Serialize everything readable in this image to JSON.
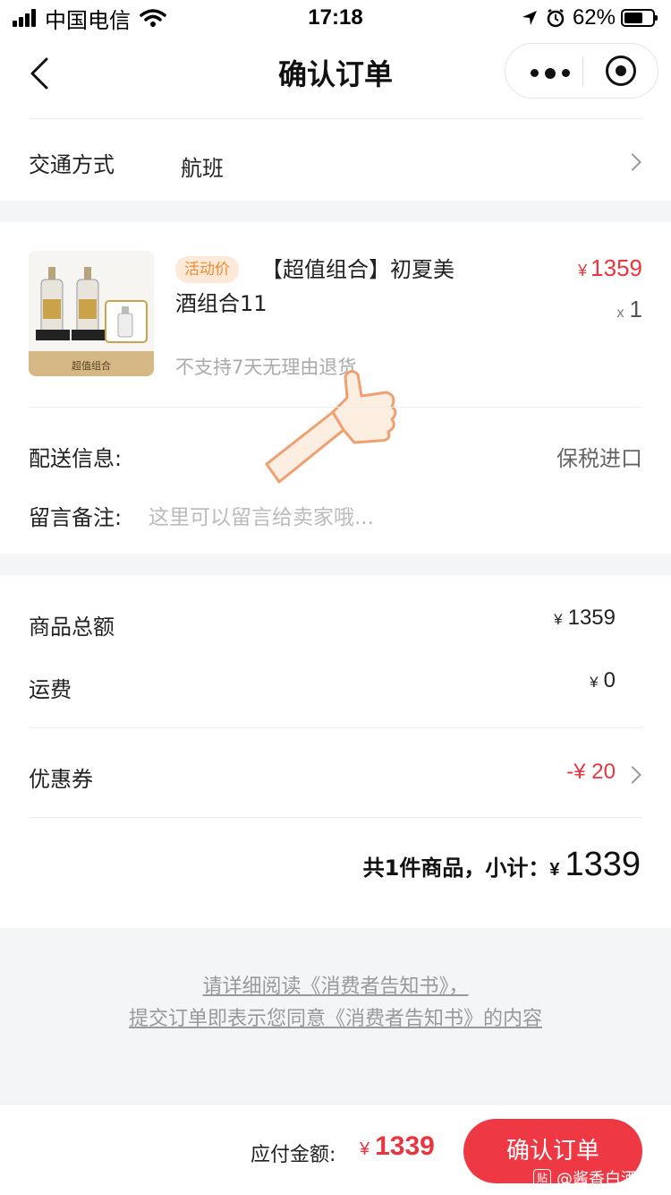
{
  "status_bar": {
    "carrier": "中国电信",
    "time": "17:18",
    "battery_percent": "62%"
  },
  "nav": {
    "title": "确认订单"
  },
  "transport": {
    "label": "交通方式",
    "value": "航班"
  },
  "product": {
    "image_caption": "超值组合",
    "badge": "活动价",
    "title": "【超值组合】初夏美酒组合11",
    "price_currency": "¥",
    "price": "1359",
    "qty_prefix": "x",
    "qty": "1",
    "return_policy": "不支持7天无理由退货"
  },
  "delivery": {
    "label": "配送信息:",
    "value": "保税进口"
  },
  "remark": {
    "label": "留言备注:",
    "placeholder": "这里可以留言给卖家哦..."
  },
  "summary": {
    "goods_total_label": "商品总额",
    "goods_total_currency": "¥",
    "goods_total": "1359",
    "shipping_label": "运费",
    "shipping_currency": "¥",
    "shipping": "0",
    "coupon_label": "优惠券",
    "coupon_value": "-¥ 20",
    "subtotal_label": "共1件商品，小计：",
    "subtotal_currency": "¥",
    "subtotal": "1339"
  },
  "notice": {
    "line1": "请详细阅读《消费者告知书》，",
    "line2": "提交订单即表示您同意《消费者告知书》的内容"
  },
  "footer": {
    "pay_label": "应付金额:",
    "pay_currency": "¥",
    "pay_amount": "1339",
    "confirm_label": "确认订单"
  },
  "watermark": {
    "icon_text": "贴",
    "text": "@酱香白酒"
  },
  "colors": {
    "accent_red": "#ee3944",
    "price_red": "#e9353f",
    "badge_orange": "#f28a2d"
  }
}
